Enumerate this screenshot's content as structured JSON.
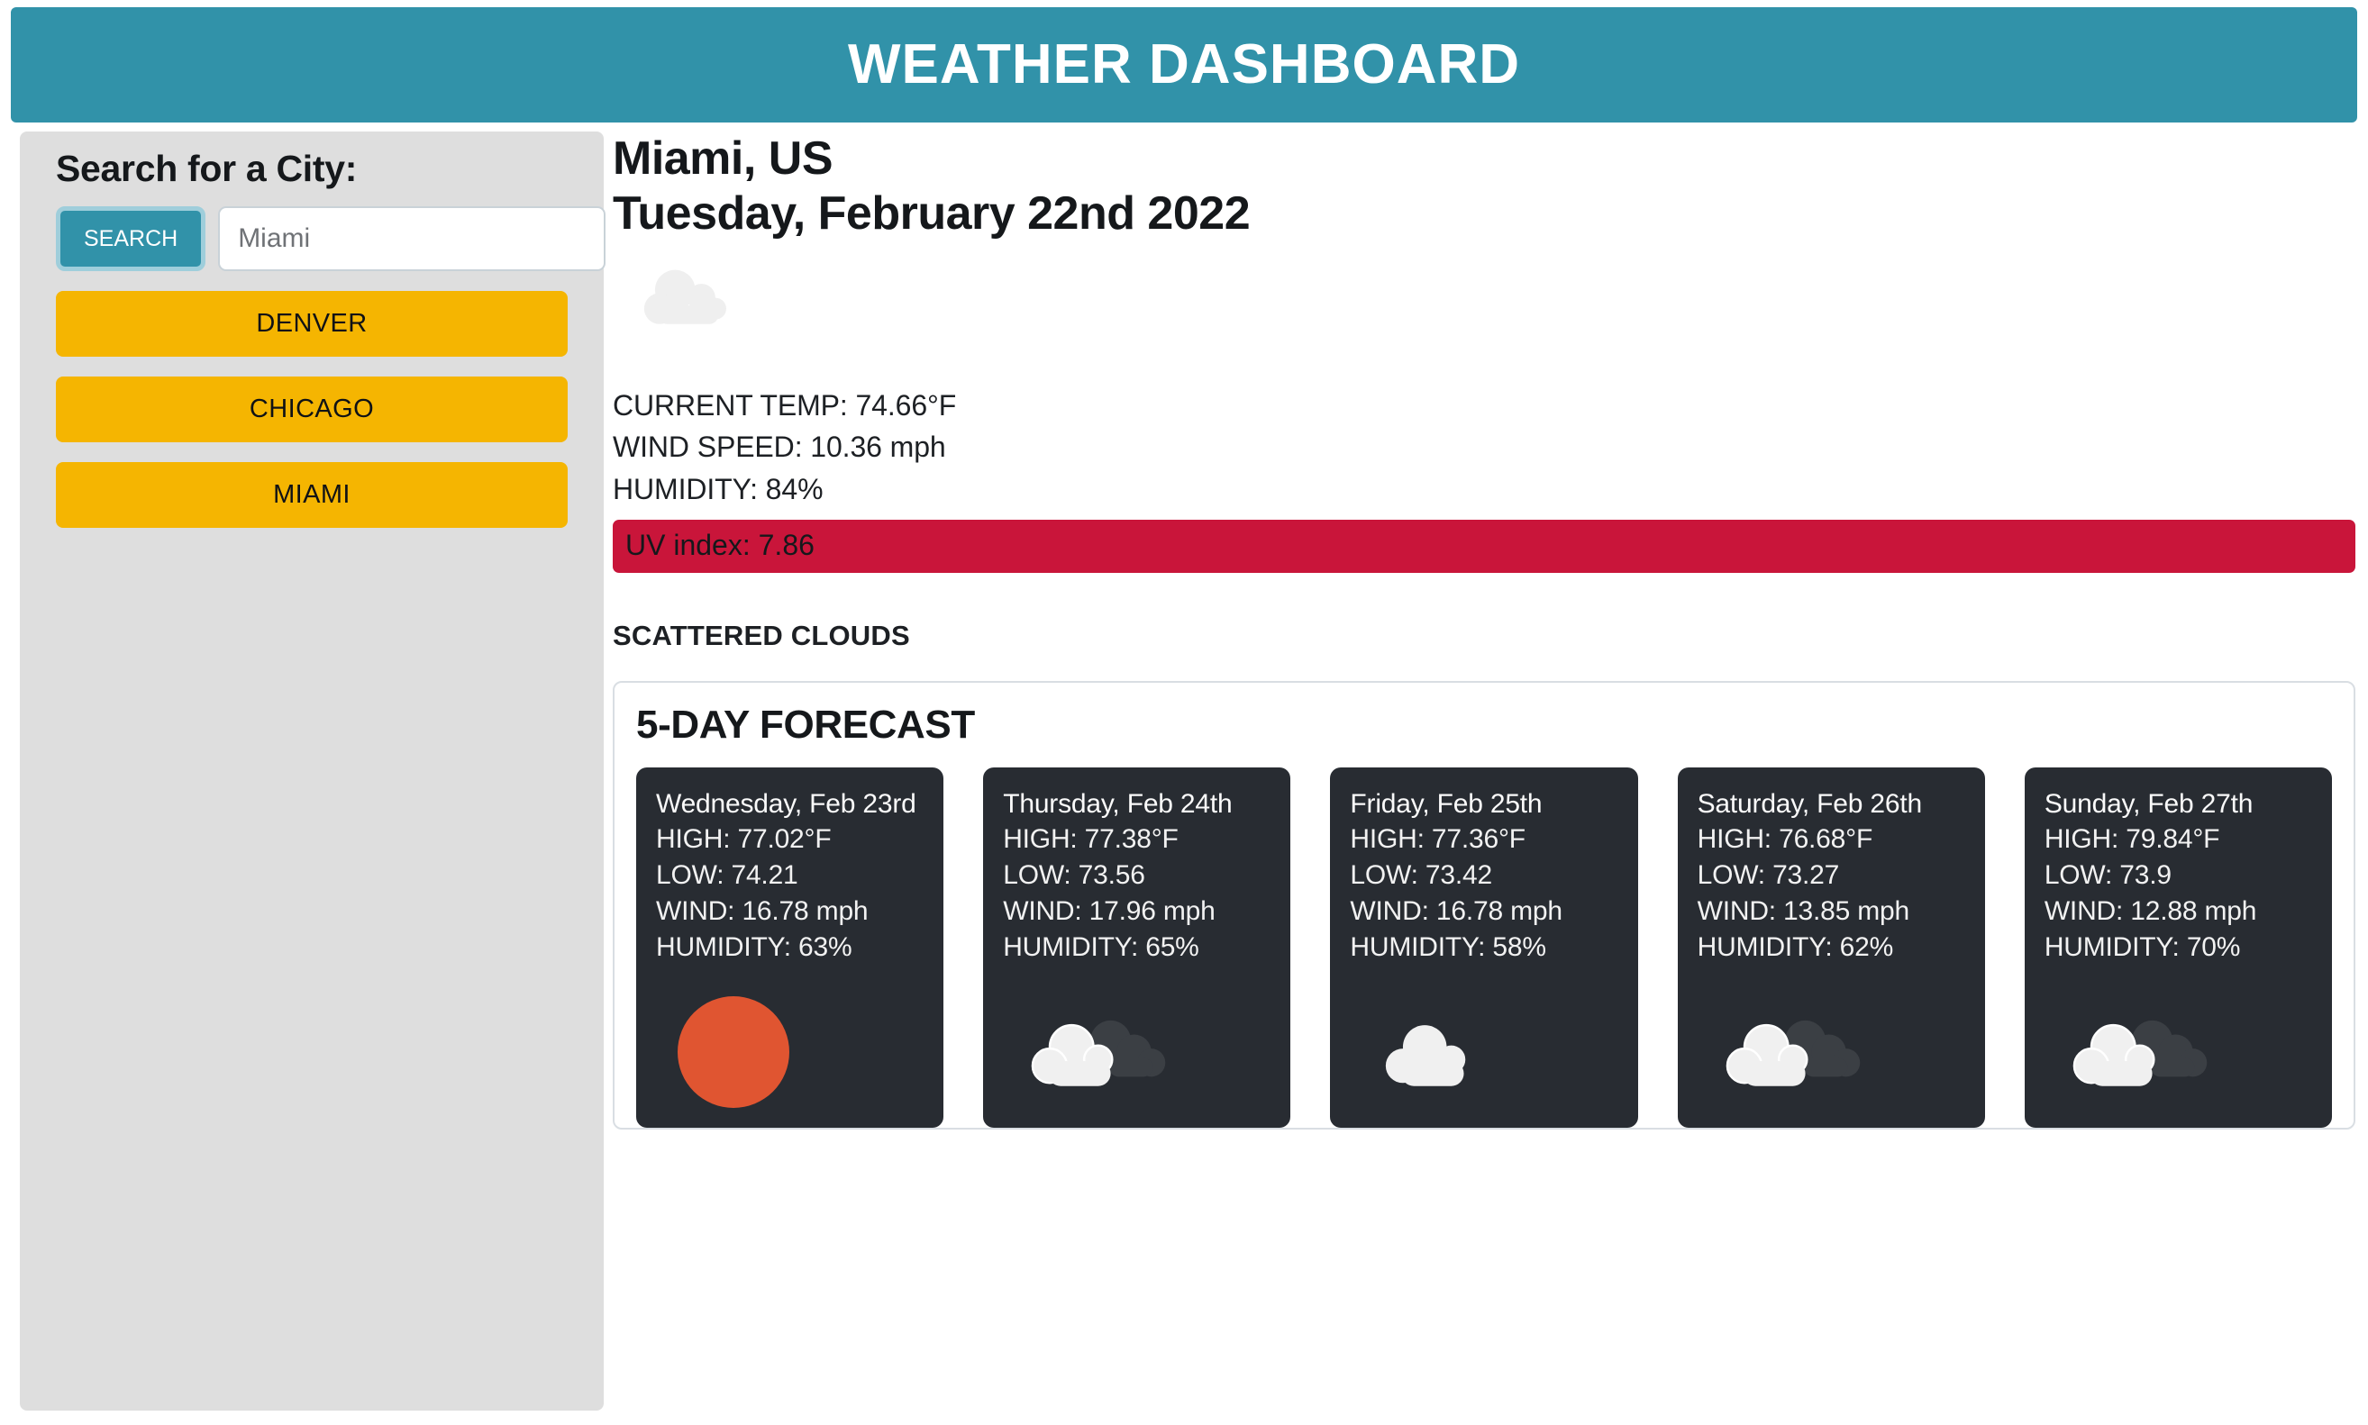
{
  "header": {
    "title": "WEATHER DASHBOARD"
  },
  "theme": {
    "teal": "#3192A9",
    "amber": "#F5B501",
    "uv_red": "#C9153A",
    "card_dark": "#282C32",
    "sun_orange": "#E05531",
    "sidebar_gray": "#DEDEDE"
  },
  "sidebar": {
    "title": "Search for a City:",
    "search_button": "SEARCH",
    "search_placeholder": "Miami",
    "search_value": "",
    "cities": [
      {
        "label": "DENVER"
      },
      {
        "label": "CHICAGO"
      },
      {
        "label": "MIAMI"
      }
    ]
  },
  "current": {
    "city": "Miami, US",
    "date": "Tuesday, February 22nd 2022",
    "icon": "cloud-icon",
    "temp_line": "CURRENT TEMP: 74.66°F",
    "wind_line": "WIND SPEED: 10.36 mph",
    "humidity_line": "HUMIDITY: 84%",
    "uv_line": "UV index: 7.86",
    "condition": "SCATTERED CLOUDS",
    "temp": "74.66",
    "wind": "10.36",
    "humidity": "84",
    "uv": "7.86"
  },
  "forecast": {
    "title": "5-DAY FORECAST",
    "days": [
      {
        "day": "Wednesday, Feb 23rd",
        "high": "HIGH: 77.02°F",
        "low": "LOW: 74.21",
        "wind": "WIND: 16.78 mph",
        "humidity": "HUMIDITY: 63%",
        "icon": "sun-icon"
      },
      {
        "day": "Thursday, Feb 24th",
        "high": "HIGH: 77.38°F",
        "low": "LOW: 73.56",
        "wind": "WIND: 17.96 mph",
        "humidity": "HUMIDITY: 65%",
        "icon": "broken-clouds-icon"
      },
      {
        "day": "Friday, Feb 25th",
        "high": "HIGH: 77.36°F",
        "low": "LOW: 73.42",
        "wind": "WIND: 16.78 mph",
        "humidity": "HUMIDITY: 58%",
        "icon": "cloud-icon"
      },
      {
        "day": "Saturday, Feb 26th",
        "high": "HIGH: 76.68°F",
        "low": "LOW: 73.27",
        "wind": "WIND: 13.85 mph",
        "humidity": "HUMIDITY: 62%",
        "icon": "broken-clouds-icon"
      },
      {
        "day": "Sunday, Feb 27th",
        "high": "HIGH: 79.84°F",
        "low": "LOW: 73.9",
        "wind": "WIND: 12.88 mph",
        "humidity": "HUMIDITY: 70%",
        "icon": "broken-clouds-icon"
      }
    ]
  }
}
